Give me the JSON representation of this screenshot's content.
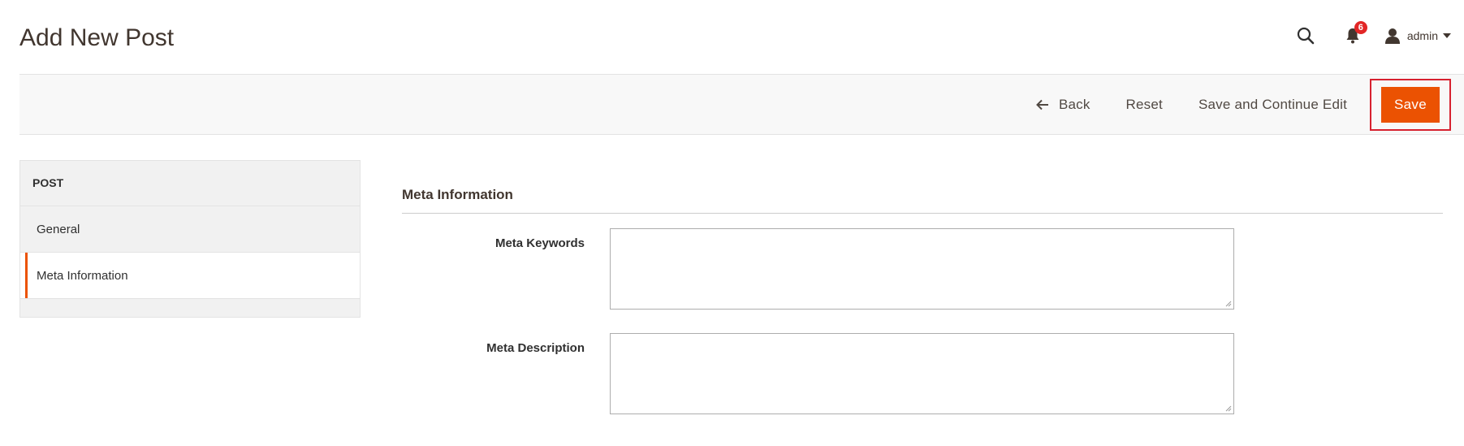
{
  "header": {
    "title": "Add New Post",
    "notifications_count": "6",
    "user_name": "admin",
    "icons": {
      "search": "search-icon",
      "notifications": "bell-icon",
      "user": "user-icon",
      "dropdown": "caret-down-icon"
    }
  },
  "toolbar": {
    "back_label": "Back",
    "reset_label": "Reset",
    "save_continue_label": "Save and Continue Edit",
    "save_label": "Save",
    "accent_color": "#eb5202",
    "highlight_color": "#d7212f"
  },
  "sidebar": {
    "title": "POST",
    "items": [
      {
        "label": "General",
        "active": false
      },
      {
        "label": "Meta Information",
        "active": true
      }
    ]
  },
  "main": {
    "section_title": "Meta Information",
    "fields": [
      {
        "label": "Meta Keywords",
        "value": "",
        "placeholder": ""
      },
      {
        "label": "Meta Description",
        "value": "",
        "placeholder": ""
      }
    ]
  }
}
